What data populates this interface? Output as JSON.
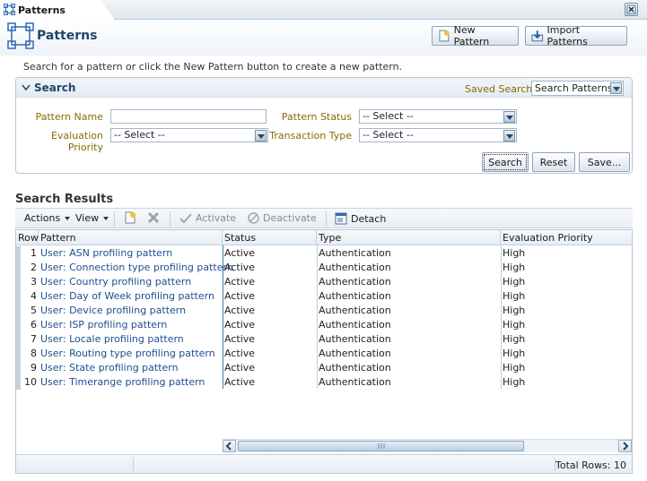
{
  "tab": {
    "label": "Patterns",
    "icon": "patterns-icon"
  },
  "header": {
    "title": "Patterns",
    "buttons": {
      "new_pattern": "New Pattern",
      "import_patterns": "Import Patterns"
    }
  },
  "hint": "Search for a pattern or click the New Pattern button to create a new pattern.",
  "search": {
    "title": "Search",
    "saved_search_label": "Saved Search",
    "saved_search_value": "Search Patterns",
    "fields": {
      "pattern_name_label": "Pattern Name",
      "pattern_name_value": "",
      "pattern_status_label": "Pattern Status",
      "pattern_status_value": "-- Select --",
      "evaluation_priority_label": "Evaluation Priority",
      "evaluation_priority_value": "-- Select --",
      "transaction_type_label": "Transaction Type",
      "transaction_type_value": "-- Select --"
    },
    "buttons": {
      "search": "Search",
      "reset": "Reset",
      "save": "Save..."
    }
  },
  "results": {
    "title": "Search Results",
    "toolbar": {
      "actions": "Actions",
      "view": "View",
      "activate": "Activate",
      "deactivate": "Deactivate",
      "detach": "Detach"
    },
    "columns": [
      "Row",
      "Pattern",
      "Status",
      "Type",
      "Evaluation Priority"
    ],
    "rows": [
      {
        "row": "1",
        "pattern": "User: ASN profiling pattern",
        "status": "Active",
        "type": "Authentication",
        "priority": "High"
      },
      {
        "row": "2",
        "pattern": "User: Connection type profiling pattern",
        "status": "Active",
        "type": "Authentication",
        "priority": "High"
      },
      {
        "row": "3",
        "pattern": "User: Country profiling pattern",
        "status": "Active",
        "type": "Authentication",
        "priority": "High"
      },
      {
        "row": "4",
        "pattern": "User: Day of Week profiling pattern",
        "status": "Active",
        "type": "Authentication",
        "priority": "High"
      },
      {
        "row": "5",
        "pattern": "User: Device profiling pattern",
        "status": "Active",
        "type": "Authentication",
        "priority": "High"
      },
      {
        "row": "6",
        "pattern": "User: ISP profiling pattern",
        "status": "Active",
        "type": "Authentication",
        "priority": "High"
      },
      {
        "row": "7",
        "pattern": "User: Locale profiling pattern",
        "status": "Active",
        "type": "Authentication",
        "priority": "High"
      },
      {
        "row": "8",
        "pattern": "User: Routing type profiling pattern",
        "status": "Active",
        "type": "Authentication",
        "priority": "High"
      },
      {
        "row": "9",
        "pattern": "User: State profiling pattern",
        "status": "Active",
        "type": "Authentication",
        "priority": "High"
      },
      {
        "row": "10",
        "pattern": "User: Timerange profiling pattern",
        "status": "Active",
        "type": "Authentication",
        "priority": "High"
      }
    ],
    "total_rows": "Total Rows: 10"
  }
}
